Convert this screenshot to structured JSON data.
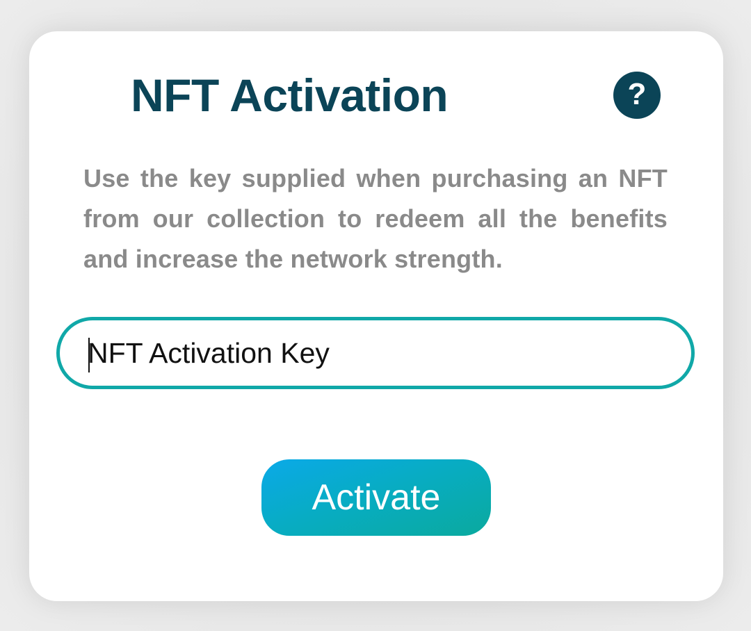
{
  "dialog": {
    "title": "NFT Activation",
    "help_icon": "question-mark-icon",
    "help_glyph": "?",
    "description": "Use the key supplied when purchasing an NFT from our collection to redeem all the benefits and increase the network strength.",
    "key_field": {
      "placeholder": "NFT Activation Key",
      "value": ""
    },
    "activate_label": "Activate"
  },
  "colors": {
    "title": "#0b4457",
    "description": "#8a8a8a",
    "input_border": "#10a8a8",
    "button_gradient_start": "#0aa9e8",
    "button_gradient_end": "#0aaa9e"
  }
}
